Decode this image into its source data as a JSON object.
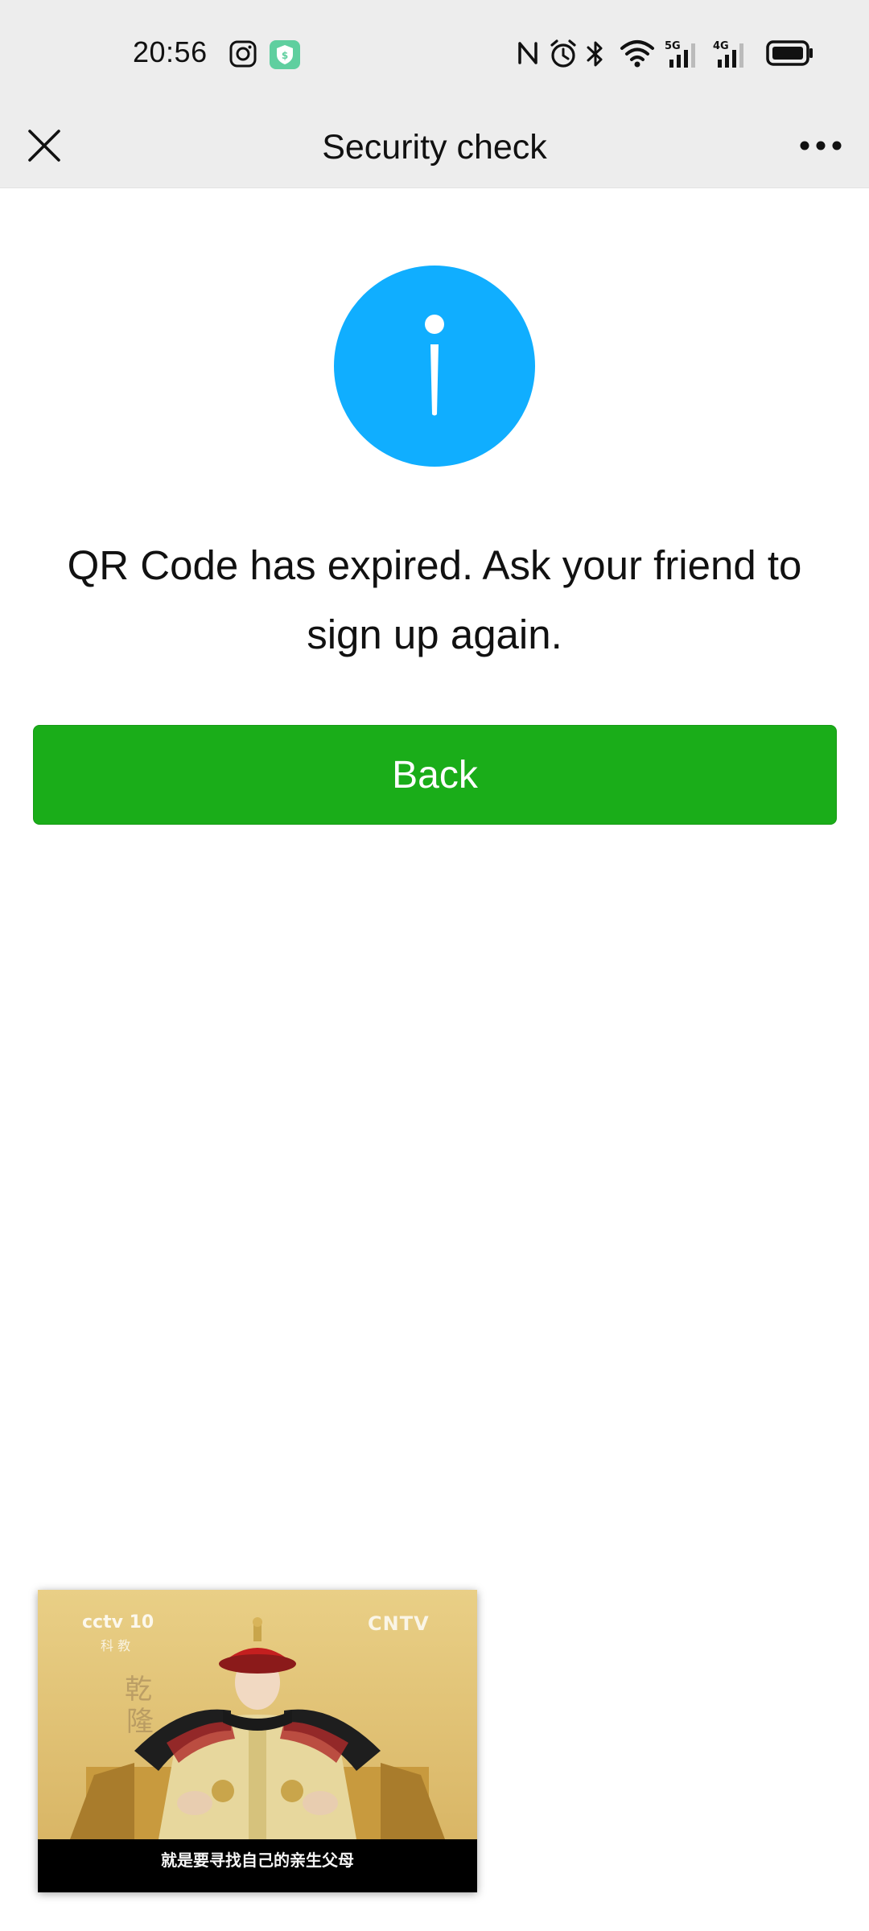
{
  "status_bar": {
    "time": "20:56",
    "notification_icons": [
      "instagram-icon",
      "shield-app-icon"
    ],
    "indicators": [
      "nfc-icon",
      "alarm-icon",
      "bluetooth-icon",
      "wifi-icon",
      "signal-5g-icon",
      "signal-4g-icon",
      "battery-icon"
    ],
    "network_labels": [
      "5G",
      "4G"
    ]
  },
  "nav": {
    "title": "Security check",
    "close_icon": "close-icon",
    "more_icon": "more-icon"
  },
  "main": {
    "icon": "info-icon",
    "icon_color": "#10aeff",
    "message": "QR Code has expired. Ask your friend to sign up again.",
    "back_label": "Back",
    "button_color": "#1aad19"
  },
  "video": {
    "channel_logo": "cctv 10",
    "channel_sub": "科 教",
    "watermark": "CNTV",
    "subtitle": "就是要寻找自己的亲生父母"
  }
}
